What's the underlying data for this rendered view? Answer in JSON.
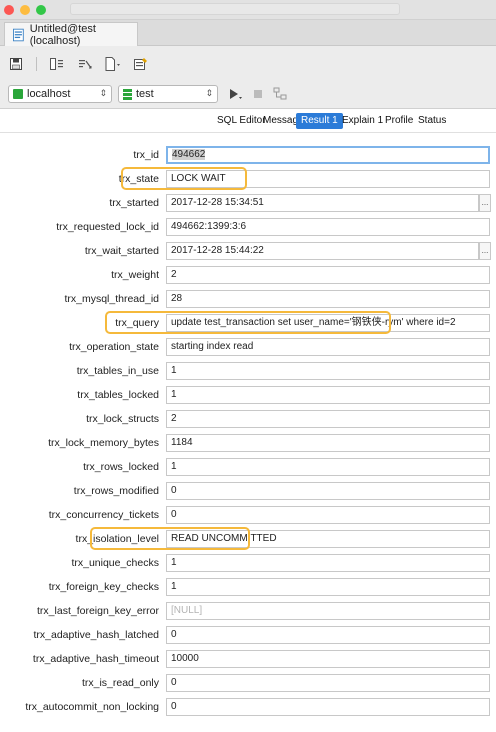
{
  "window": {
    "tab_title": "Untitled@test (localhost)"
  },
  "toolbar": {
    "icons": [
      "save-icon",
      "query-format-icon",
      "query-beautify-icon",
      "query-doc-icon",
      "query-build-icon"
    ]
  },
  "connection": {
    "selected": "localhost"
  },
  "database": {
    "selected": "test"
  },
  "result_tabs": [
    {
      "label": "SQL Editor",
      "active": false
    },
    {
      "label": "Message",
      "active": false
    },
    {
      "label": "Result 1",
      "active": true
    },
    {
      "label": "Explain 1",
      "active": false
    },
    {
      "label": "Profile",
      "active": false
    },
    {
      "label": "Status",
      "active": false
    }
  ],
  "fields": [
    {
      "label": "trx_id",
      "value": "494662"
    },
    {
      "label": "trx_state",
      "value": "LOCK WAIT"
    },
    {
      "label": "trx_started",
      "value": "2017-12-28 15:34:51"
    },
    {
      "label": "trx_requested_lock_id",
      "value": "494662:1399:3:6"
    },
    {
      "label": "trx_wait_started",
      "value": "2017-12-28 15:44:22"
    },
    {
      "label": "trx_weight",
      "value": "2"
    },
    {
      "label": "trx_mysql_thread_id",
      "value": "28"
    },
    {
      "label": "trx_query",
      "value": "update test_transaction set user_name='钢铁侠-rym' where id=2"
    },
    {
      "label": "trx_operation_state",
      "value": "starting index read"
    },
    {
      "label": "trx_tables_in_use",
      "value": "1"
    },
    {
      "label": "trx_tables_locked",
      "value": "1"
    },
    {
      "label": "trx_lock_structs",
      "value": "2"
    },
    {
      "label": "trx_lock_memory_bytes",
      "value": "1184"
    },
    {
      "label": "trx_rows_locked",
      "value": "1"
    },
    {
      "label": "trx_rows_modified",
      "value": "0"
    },
    {
      "label": "trx_concurrency_tickets",
      "value": "0"
    },
    {
      "label": "trx_isolation_level",
      "value": "READ UNCOMMITTED"
    },
    {
      "label": "trx_unique_checks",
      "value": "1"
    },
    {
      "label": "trx_foreign_key_checks",
      "value": "1"
    },
    {
      "label": "trx_last_foreign_key_error",
      "value": "[NULL]"
    },
    {
      "label": "trx_adaptive_hash_latched",
      "value": "0"
    },
    {
      "label": "trx_adaptive_hash_timeout",
      "value": "10000"
    },
    {
      "label": "trx_is_read_only",
      "value": "0"
    },
    {
      "label": "trx_autocommit_non_locking",
      "value": "0"
    }
  ],
  "highlighted_fields": [
    "trx_state",
    "trx_query",
    "trx_isolation_level"
  ],
  "colors": {
    "active_tab": "#2b7bd8",
    "highlight": "#f5b93b",
    "focus_border": "#7eb4ea"
  }
}
